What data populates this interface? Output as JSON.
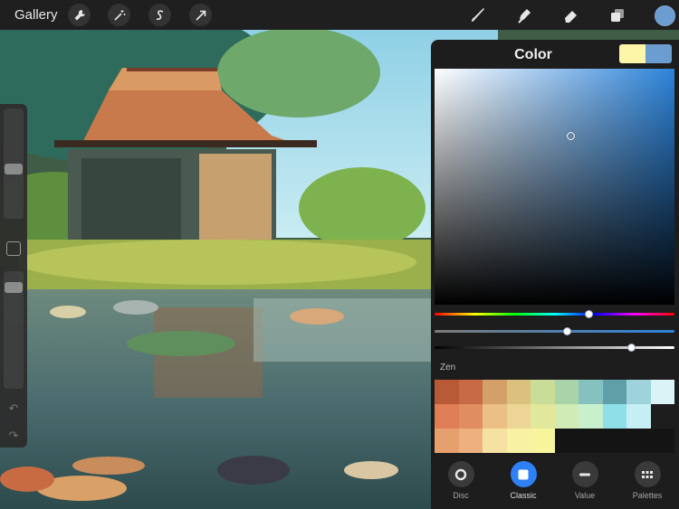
{
  "toolbar": {
    "gallery_label": "Gallery",
    "left_tools": [
      "wrench-icon",
      "magic-wand-icon",
      "selection-s-icon",
      "transform-arrow-icon"
    ],
    "right_tools": [
      "brush-icon",
      "smudge-icon",
      "eraser-icon",
      "layers-icon",
      "color-swatch"
    ],
    "current_color": "#6c9dd0"
  },
  "color_panel": {
    "title": "Color",
    "current_color": "#fdf6a8",
    "previous_color": "#6c9dd0",
    "hue_level": 0.64,
    "saturation_level": 0.55,
    "value_level": 0.82,
    "palette": {
      "name": "Zen",
      "swatches": [
        "#b85a35",
        "#c96a46",
        "#d4a06a",
        "#dcc07e",
        "#c9dc98",
        "#a9d3a8",
        "#85c2bf",
        "#5e9fa8",
        "#9ed3dc",
        "#d9f3f6",
        "#df7d55",
        "#e08e61",
        "#ebbf86",
        "#ecd596",
        "#e1e79b",
        "#d0ecb4",
        "#c8f0cd",
        "#8fdfe8",
        "#c5eff4",
        "#1d1d1d",
        "#e5a06e",
        "#eeb07e",
        "#f5e1a1",
        "#f8f1a4",
        "#f6f59e",
        "#141414",
        "#141414",
        "#141414",
        "#141414",
        "#141414"
      ]
    },
    "tabs": [
      {
        "label": "Disc",
        "icon": "disc-icon",
        "active": false
      },
      {
        "label": "Classic",
        "icon": "classic-square-icon",
        "active": true
      },
      {
        "label": "Value",
        "icon": "value-bar-icon",
        "active": false
      },
      {
        "label": "Palettes",
        "icon": "palettes-grid-icon",
        "active": false
      }
    ]
  },
  "sidebar": {
    "brush_size_level": 0.55,
    "opacity_level": 0.1
  }
}
